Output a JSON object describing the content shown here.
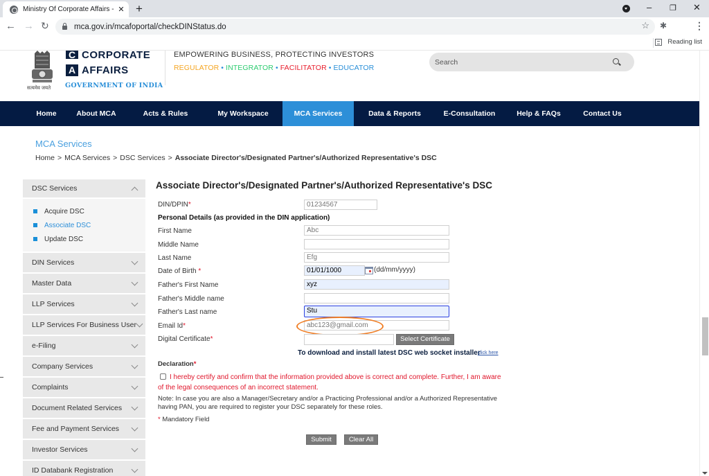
{
  "browser": {
    "tab_title": "Ministry Of Corporate Affairs - M",
    "new_tab_label": "+",
    "url": "mca.gov.in/mcafoportal/checkDINStatus.do",
    "reading_list_label": "Reading list",
    "window_controls": {
      "minimize": "–",
      "restore": "❐",
      "close": "✕"
    }
  },
  "header": {
    "logo_line1_letter": "C",
    "logo_line1": "CORPORATE",
    "logo_line2_letter": "A",
    "logo_line2": "AFFAIRS",
    "logo_line3": "GOVERNMENT OF INDIA",
    "emblem_caption": "सत्यमेव जयते",
    "tagline": "EMPOWERING BUSINESS, PROTECTING INVESTORS",
    "roles": [
      {
        "label": "REGULATOR",
        "color": "#f5a623"
      },
      {
        "label": "INTEGRATOR",
        "color": "#2ecc71"
      },
      {
        "label": "FACILITATOR",
        "color": "#e8202e"
      },
      {
        "label": "EDUCATOR",
        "color": "#2a8fd8"
      }
    ],
    "role_separator": "•",
    "search_placeholder": "Search"
  },
  "nav": {
    "items": [
      {
        "label": "Home",
        "active": false
      },
      {
        "label": "About MCA",
        "active": false
      },
      {
        "label": "Acts & Rules",
        "active": false
      },
      {
        "label": "My Workspace",
        "active": false
      },
      {
        "label": "MCA Services",
        "active": true
      },
      {
        "label": "Data & Reports",
        "active": false
      },
      {
        "label": "E-Consultation",
        "active": false
      },
      {
        "label": "Help & FAQs",
        "active": false
      },
      {
        "label": "Contact Us",
        "active": false
      }
    ],
    "active_color": "#2d8fd8",
    "bar_color": "#041b43"
  },
  "section_title": "MCA Services",
  "breadcrumb": {
    "items": [
      "Home",
      "MCA Services",
      "DSC Services"
    ],
    "separator": ">",
    "current": "Associate Director's/Designated Partner's/Authorized Representative's DSC"
  },
  "sidebar": {
    "expanded": {
      "label": "DSC Services",
      "children": [
        {
          "label": "Acquire DSC",
          "active": false
        },
        {
          "label": "Associate DSC",
          "active": true
        },
        {
          "label": "Update DSC",
          "active": false
        }
      ]
    },
    "collapsed": [
      "DIN Services",
      "Master Data",
      "LLP Services",
      "LLP Services For Business User",
      "e-Filing",
      "Company Services",
      "Complaints",
      "Document Related Services",
      "Fee and Payment Services",
      "Investor Services",
      "ID Databank Registration"
    ]
  },
  "form": {
    "title": "Associate Director's/Designated Partner's/Authorized Representative's DSC",
    "din_label": "DIN/DPIN",
    "din_value": "01234567",
    "personal_heading": "Personal Details (as provided in the DIN application)",
    "first_name_label": "First Name",
    "first_name_value": "Abc",
    "middle_name_label": "Middle Name",
    "middle_name_value": "",
    "last_name_label": "Last Name",
    "last_name_value": "Efg",
    "dob_label": "Date of Birth",
    "dob_value": "01/01/1000",
    "dob_format": "(dd/mm/yyyy)",
    "father_first_label": "Father's First Name",
    "father_first_value": "xyz",
    "father_middle_label": "Father's Middle name",
    "father_middle_value": "",
    "father_last_label": "Father's Last name",
    "father_last_value": "Stu",
    "email_label": "Email Id",
    "email_value": "abc123@gmail.com",
    "cert_label": "Digital Certificate",
    "cert_value": "",
    "select_cert_button": "Select Certificate",
    "download_text": "To download and install latest DSC web socket installer",
    "download_link": "click here",
    "declaration_label": "Declaration",
    "declaration_text": "I hereby certify and confirm that the information provided above is correct and complete. Further, I am aware of the legal consequences of an incorrect statement.",
    "declaration_checked": false,
    "note_text": "Note: In case you are also a Manager/Secretary and/or a Practicing Professional and/or a Authorized Representative having PAN, you are required to register your DSC separately for these roles.",
    "mandatory_note": "Mandatory Field",
    "required_marker": "*",
    "submit_button": "Submit",
    "clear_button": "Clear All"
  }
}
